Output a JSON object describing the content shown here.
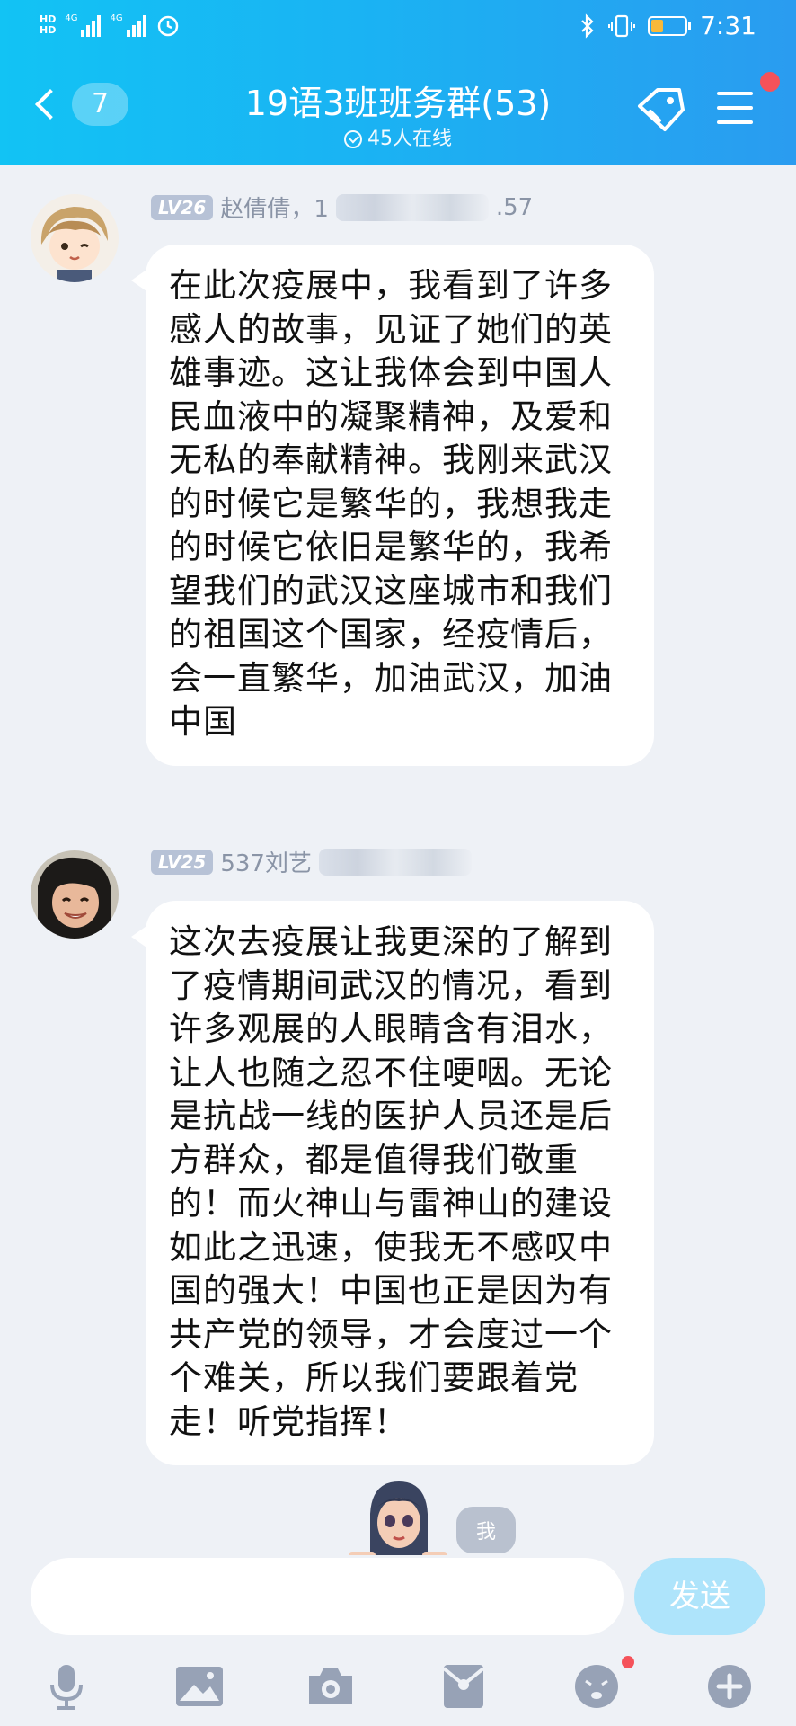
{
  "status_bar": {
    "left_badges": [
      "HD",
      "HD"
    ],
    "network_labels": [
      "4G",
      "4G"
    ],
    "time": "7:31",
    "battery_level": 0.35
  },
  "header": {
    "unread_count": "7",
    "title": "19语3班班务群(53)",
    "online_text": "45人在线"
  },
  "messages": [
    {
      "level": "LV26",
      "sender": "赵倩倩，1",
      "sender_tail": ".57",
      "text": "在此次疫展中，我看到了许多感人的故事，见证了她们的英雄事迹。这让我体会到中国人民血液中的凝聚精神，及爱和无私的奉献精神。我刚来武汉的时候它是繁华的，我想我走的时候它依旧是繁华的，我希望我们的武汉这座城市和我们的祖国这个国家，经疫情后，会一直繁华，加油武汉，加油中国"
    },
    {
      "level": "LV25",
      "sender": "537刘艺",
      "sender_tail": "",
      "text": "这次去疫展让我更深的了解到了疫情期间武汉的情况，看到许多观展的人眼睛含有泪水，让人也随之忍不住哽咽。无论是抗战一线的医护人员还是后方群众，都是值得我们敬重的！而火神山与雷神山的建设如此之迅速，使我无不感叹中国的强大！中国也正是因为有共产党的领导，才会度过一个个难关，所以我们要跟着党走！听党指挥！"
    }
  ],
  "me_label": "我",
  "input": {
    "placeholder": "",
    "send_label": "发送"
  },
  "toolbar_icons": [
    "microphone-icon",
    "image-icon",
    "camera-icon",
    "red-packet-icon",
    "emoji-icon",
    "plus-icon"
  ],
  "colors": {
    "header_start": "#12c3f4",
    "header_end": "#2a9cf0",
    "badge_red": "#f5525a",
    "send_disabled": "#aee4fb"
  }
}
